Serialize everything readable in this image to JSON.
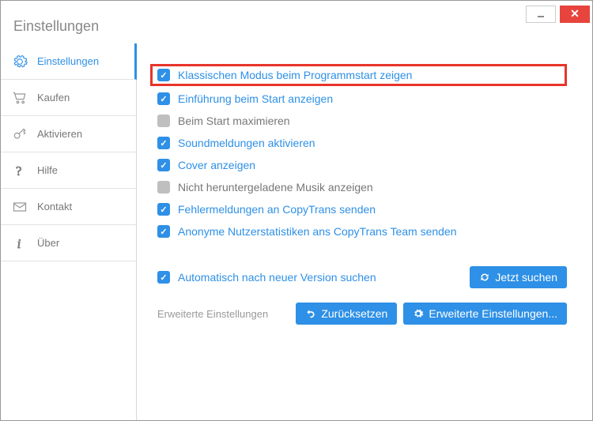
{
  "window": {
    "title": "Einstellungen"
  },
  "sidebar": {
    "items": [
      {
        "label": "Einstellungen",
        "icon": "gear"
      },
      {
        "label": "Kaufen",
        "icon": "cart"
      },
      {
        "label": "Aktivieren",
        "icon": "key"
      },
      {
        "label": "Hilfe",
        "icon": "help"
      },
      {
        "label": "Kontakt",
        "icon": "mail"
      },
      {
        "label": "Über",
        "icon": "info"
      }
    ]
  },
  "options": [
    {
      "label": "Klassischen Modus beim Programmstart zeigen",
      "checked": true,
      "highlight": true
    },
    {
      "label": "Einführung beim Start anzeigen",
      "checked": true
    },
    {
      "label": "Beim Start maximieren",
      "checked": false
    },
    {
      "label": "Soundmeldungen aktivieren",
      "checked": true
    },
    {
      "label": "Cover anzeigen",
      "checked": true
    },
    {
      "label": "Nicht heruntergeladene Musik anzeigen",
      "checked": false
    },
    {
      "label": "Fehlermeldungen an CopyTrans senden",
      "checked": true
    },
    {
      "label": "Anonyme Nutzerstatistiken ans CopyTrans Team senden",
      "checked": true
    }
  ],
  "update": {
    "label": "Automatisch nach neuer Version suchen",
    "checked": true,
    "button": "Jetzt suchen"
  },
  "advanced": {
    "label": "Erweiterte Einstellungen",
    "reset": "Zurücksetzen",
    "open": "Erweiterte Einstellungen..."
  }
}
